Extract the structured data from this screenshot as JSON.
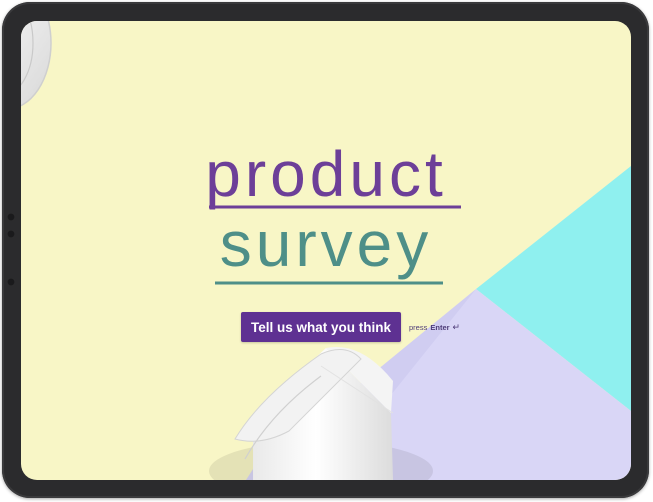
{
  "title": {
    "line1": "product",
    "line2": "survey"
  },
  "cta": {
    "label": "Tell us what you think",
    "hint_prefix": "press",
    "hint_key": "Enter",
    "hint_icon": "↵"
  },
  "colors": {
    "background_yellow": "#f8f6c6",
    "accent_cyan": "#8ff0ef",
    "accent_lavender": "#d9d6f6",
    "title_purple": "#6d3f98",
    "title_teal": "#4e8f88",
    "button_purple": "#5e3192"
  }
}
